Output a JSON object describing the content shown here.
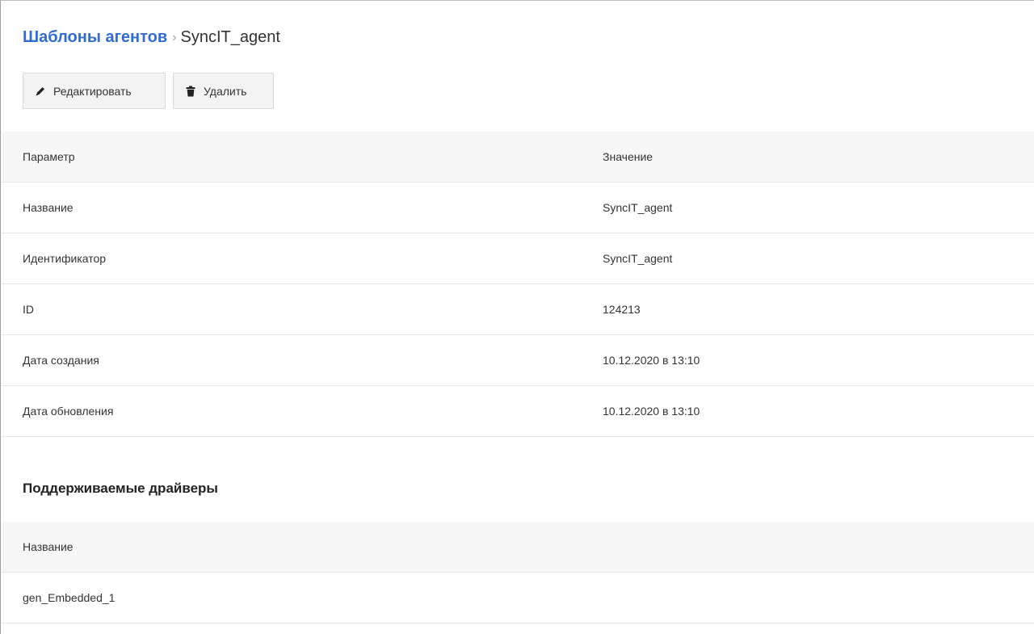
{
  "breadcrumb": {
    "parent": "Шаблоны агентов",
    "separator": "›",
    "current": "SyncIT_agent"
  },
  "toolbar": {
    "edit_label": "Редактировать",
    "edit_icon": "pencil-icon",
    "delete_label": "Удалить",
    "delete_icon": "trash-icon"
  },
  "params_table": {
    "headers": [
      "Параметр",
      "Значение"
    ],
    "rows": [
      [
        "Название",
        "SyncIT_agent"
      ],
      [
        "Идентификатор",
        "SyncIT_agent"
      ],
      [
        "ID",
        "124213"
      ],
      [
        "Дата создания",
        "10.12.2020 в 13:10"
      ],
      [
        "Дата обновления",
        "10.12.2020 в 13:10"
      ]
    ]
  },
  "drivers_section": {
    "title": "Поддерживаемые драйверы",
    "headers": [
      "Название"
    ],
    "rows": [
      [
        "gen_Embedded_1"
      ]
    ]
  },
  "colors": {
    "link": "#2f6cd4",
    "header_bg": "#f7f7f7",
    "button_bg": "#f3f3f3",
    "row_border": "#e6e6e6"
  }
}
